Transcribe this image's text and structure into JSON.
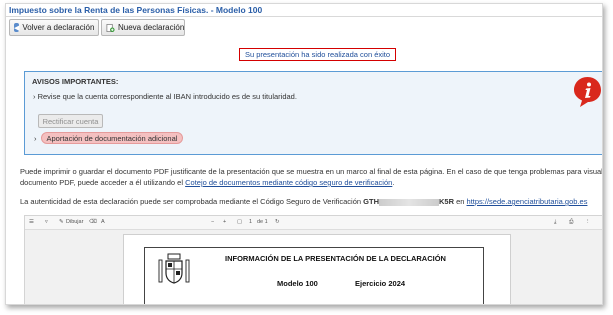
{
  "header": {
    "title": "Impuesto sobre la Renta de las Personas Físicas. - Modelo 100"
  },
  "toolbar": {
    "back_label": "Volver a declaración",
    "new_label": "Nueva declaración"
  },
  "status": {
    "success_text": "Su presentación ha sido realizada con éxito",
    "success_border_color": "#d40000"
  },
  "avisos": {
    "title": "AVISOS IMPORTANTES:",
    "item_text": "Revise que la cuenta correspondiente al IBAN introducido es de su titularidad.",
    "rectify_label": "Rectificar cuenta",
    "aportacion_label": "Aportación de documentación adicional",
    "icon": "info-icon",
    "border_color": "#5b9bd5",
    "bg_color": "#eef4fa"
  },
  "info": {
    "line1": "Puede imprimir o guardar el documento PDF justificante de la presentación que se muestra en un marco al final de esta página. En el caso de que tenga problemas para visualizar dicho",
    "line2_prefix": "documento PDF, puede acceder a él utilizando el ",
    "line2_link": "Cotejo de documentos mediante código seguro de verificación",
    "line2_suffix": ".",
    "line3_prefix": "La autenticidad de esta declaración puede ser comprobada mediante el Código Seguro de Verificación ",
    "csv_start": "GTH",
    "csv_end": "K5R",
    "line3_middle": " en ",
    "line3_link": "https://sede.agenciatributaria.gob.es"
  },
  "pdf_viewer": {
    "toolbar": {
      "draw_label": "Dibujar",
      "page_current": "1",
      "page_total": "de 1"
    },
    "document": {
      "title": "INFORMACIÓN DE LA PRESENTACIÓN DE LA DECLARACIÓN",
      "model": "Modelo 100",
      "year": "Ejercicio 2024"
    }
  }
}
